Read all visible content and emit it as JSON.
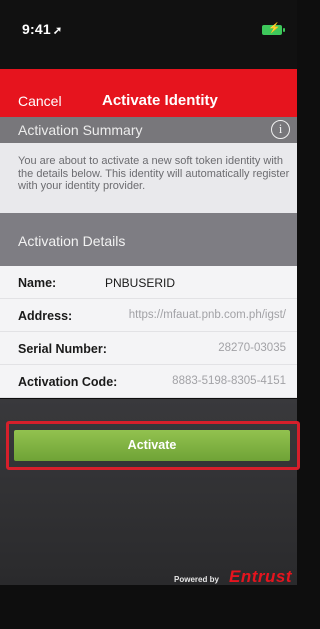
{
  "status_bar": {
    "time": "9:41",
    "location_arrow": "➚",
    "battery_icon": "battery-charging-icon"
  },
  "nav": {
    "cancel_label": "Cancel",
    "title": "Activate Identity"
  },
  "summary": {
    "title": "Activation Summary",
    "info_icon": "ⓘ",
    "text": "You are about to activate a new soft token identity with the details below. This identity will automatically register with your identity provider."
  },
  "details": {
    "title": "Activation Details",
    "rows": [
      {
        "label": "Name:",
        "value": "PNBUSERID"
      },
      {
        "label": "Address:",
        "value": "https://mfauat.pnb.com.ph/igst/"
      },
      {
        "label": "Serial Number:",
        "value": "28270-03035"
      },
      {
        "label": "Activation Code:",
        "value": "8883-5198-8305-4151"
      }
    ]
  },
  "activate_button": {
    "label": "Activate"
  },
  "footer": {
    "powered_by": "Powered by",
    "brand": "Entrust"
  },
  "colors": {
    "nav_red": "#e6141e",
    "button_green": "#7db443",
    "highlight_red": "#d61f2b"
  }
}
